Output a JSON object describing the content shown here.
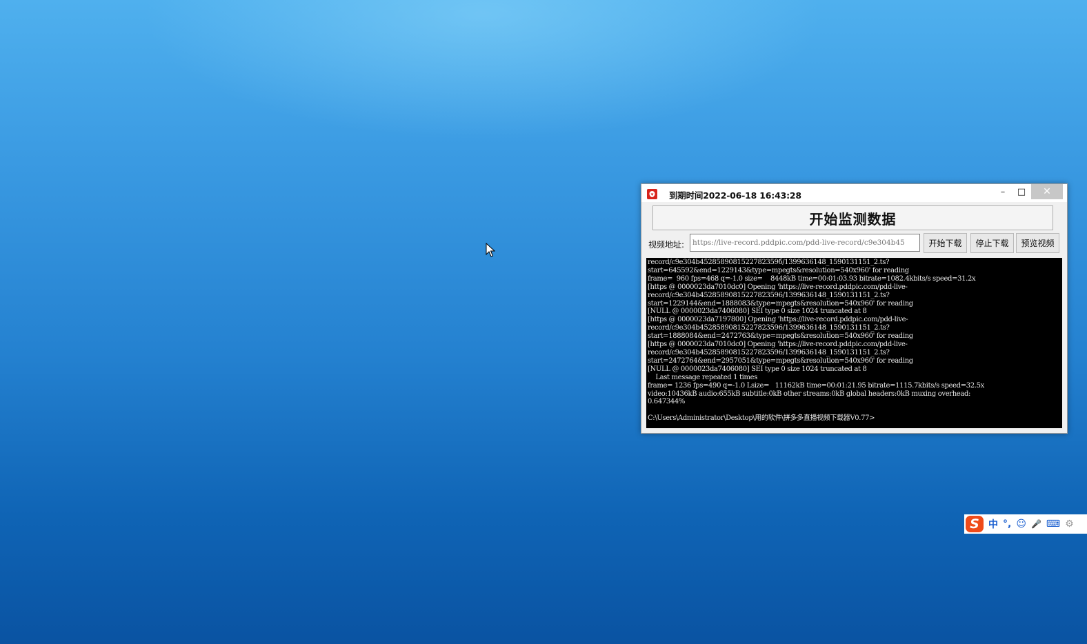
{
  "window": {
    "title": "到期时间2022-06-18 16:43:28",
    "minimize_glyph": "–",
    "maximize_glyph": "□",
    "close_glyph": "✕"
  },
  "main": {
    "monitor_button": "开始监测数据",
    "url_label": "视频地址:",
    "url_value": "https://live-record.pddpic.com/pdd-live-record/c9e304b45",
    "start_download": "开始下载",
    "stop_download": "停止下载",
    "preview_video": "预览视频"
  },
  "console": {
    "text": "record/c9e304b4528589081522782359б/1399636148_1590131151_2.ts?\nstart=645592&end=1229143&type=mpegts&resolution=540x960' for reading\nframe=  960 fps=468 q=-1.0 size=    8448kB time=00:01:03.93 bitrate=1082.4kbits/s speed=31.2x\n[https @ 0000023da7010dc0] Opening 'https://live-record.pddpic.com/pdd-live-\nrecord/c9e304b45285890815227823596/1399636148_1590131151_2.ts?\nstart=1229144&end=1888083&type=mpegts&resolution=540x960' for reading\n[NULL @ 0000023da7406080] SEI type 0 size 1024 truncated at 8\n[https @ 0000023da7197800] Opening 'https://live-record.pddpic.com/pdd-live-\nrecord/c9e304b45285890815227823596/1399636148_1590131151_2.ts?\nstart=1888084&end=2472763&type=mpegts&resolution=540x960' for reading\n[https @ 0000023da7010dc0] Opening 'https://live-record.pddpic.com/pdd-live-\nrecord/c9e304b45285890815227823596/1399636148_1590131151_2.ts?\nstart=2472764&end=2957051&type=mpegts&resolution=540x960' for reading\n[NULL @ 0000023da7406080] SEI type 0 size 1024 truncated at 8\n    Last message repeated 1 times\nframe= 1236 fps=490 q=-1.0 Lsize=   11162kB time=00:01:21.95 bitrate=1115.7kbits/s speed=32.5x\nvideo:10436kB audio:655kB subtitle:0kB other streams:0kB global headers:0kB muxing overhead:\n0.647344%\n\nC:\\Users\\Administrator\\Desktop\\用的软件\\拼多多直播视频下载器V0.77>"
  },
  "ime": {
    "logo": "S",
    "mode": "中",
    "punct": "°,",
    "emoji_glyph": "☺",
    "mic_glyph": "🎤",
    "keyboard_glyph": "⌨",
    "more_glyph": "⚙"
  }
}
